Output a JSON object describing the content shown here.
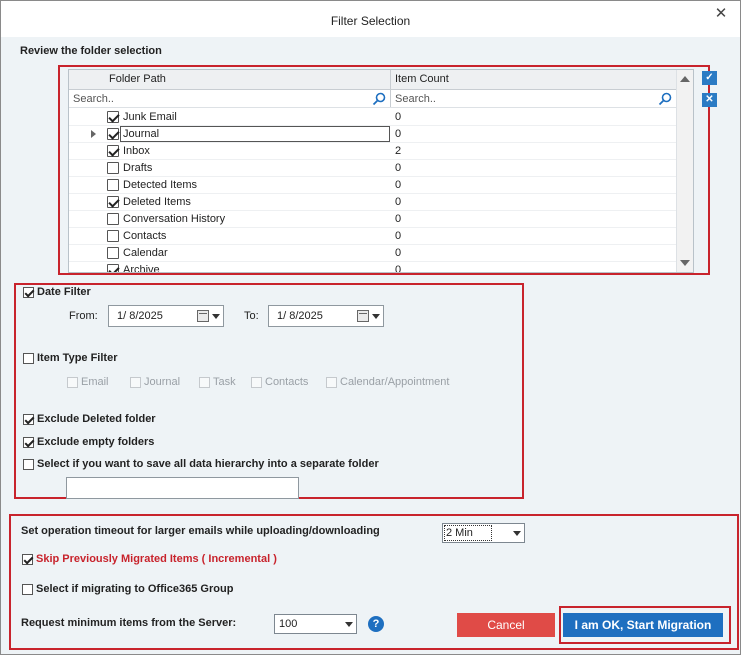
{
  "window": {
    "title": "Filter Selection",
    "close": "✕"
  },
  "review_label": "Review the folder selection",
  "grid": {
    "columns": [
      "Folder Path",
      "Item Count"
    ],
    "search_placeholder_path": "Search..",
    "search_placeholder_count": "Search..",
    "rows": [
      {
        "name": "Junk Email",
        "count": "0",
        "checked": true
      },
      {
        "name": "Journal",
        "count": "0",
        "checked": true,
        "selected": true
      },
      {
        "name": "Inbox",
        "count": "2",
        "checked": true
      },
      {
        "name": "Drafts",
        "count": "0",
        "checked": false
      },
      {
        "name": "Detected Items",
        "count": "0",
        "checked": false
      },
      {
        "name": "Deleted Items",
        "count": "0",
        "checked": true
      },
      {
        "name": "Conversation History",
        "count": "0",
        "checked": false
      },
      {
        "name": "Contacts",
        "count": "0",
        "checked": false
      },
      {
        "name": "Calendar",
        "count": "0",
        "checked": false
      },
      {
        "name": "Archive",
        "count": "0",
        "checked": true
      }
    ]
  },
  "filters": {
    "date_filter": {
      "label": "Date Filter",
      "checked": true,
      "from_label": "From:",
      "from_value": "1/  8/2025",
      "to_label": "To:",
      "to_value": "1/  8/2025"
    },
    "item_type_filter": {
      "label": "Item Type Filter",
      "checked": false,
      "types": [
        "Email",
        "Journal",
        "Task",
        "Contacts",
        "Calendar/Appointment"
      ]
    },
    "exclude_deleted": {
      "label": "Exclude Deleted folder",
      "checked": true
    },
    "exclude_empty": {
      "label": "Exclude empty folders",
      "checked": true
    },
    "save_hierarchy": {
      "label": "Select if you want to save all data hierarchy into a separate folder",
      "checked": false,
      "value": ""
    }
  },
  "options": {
    "timeout_label": "Set operation timeout for larger emails while uploading/downloading",
    "timeout_value": "2 Min",
    "skip_label": "Skip Previously Migrated Items ( Incremental )",
    "skip_checked": true,
    "o365_label": "Select if migrating to Office365 Group",
    "o365_checked": false,
    "min_items_label": "Request minimum items from the Server:",
    "min_items_value": "100",
    "help": "?"
  },
  "buttons": {
    "cancel": "Cancel",
    "start": "I am OK, Start Migration"
  },
  "colors": {
    "accent": "#1e6fc0",
    "danger": "#e04b47",
    "highlight_border": "#c8232c"
  }
}
